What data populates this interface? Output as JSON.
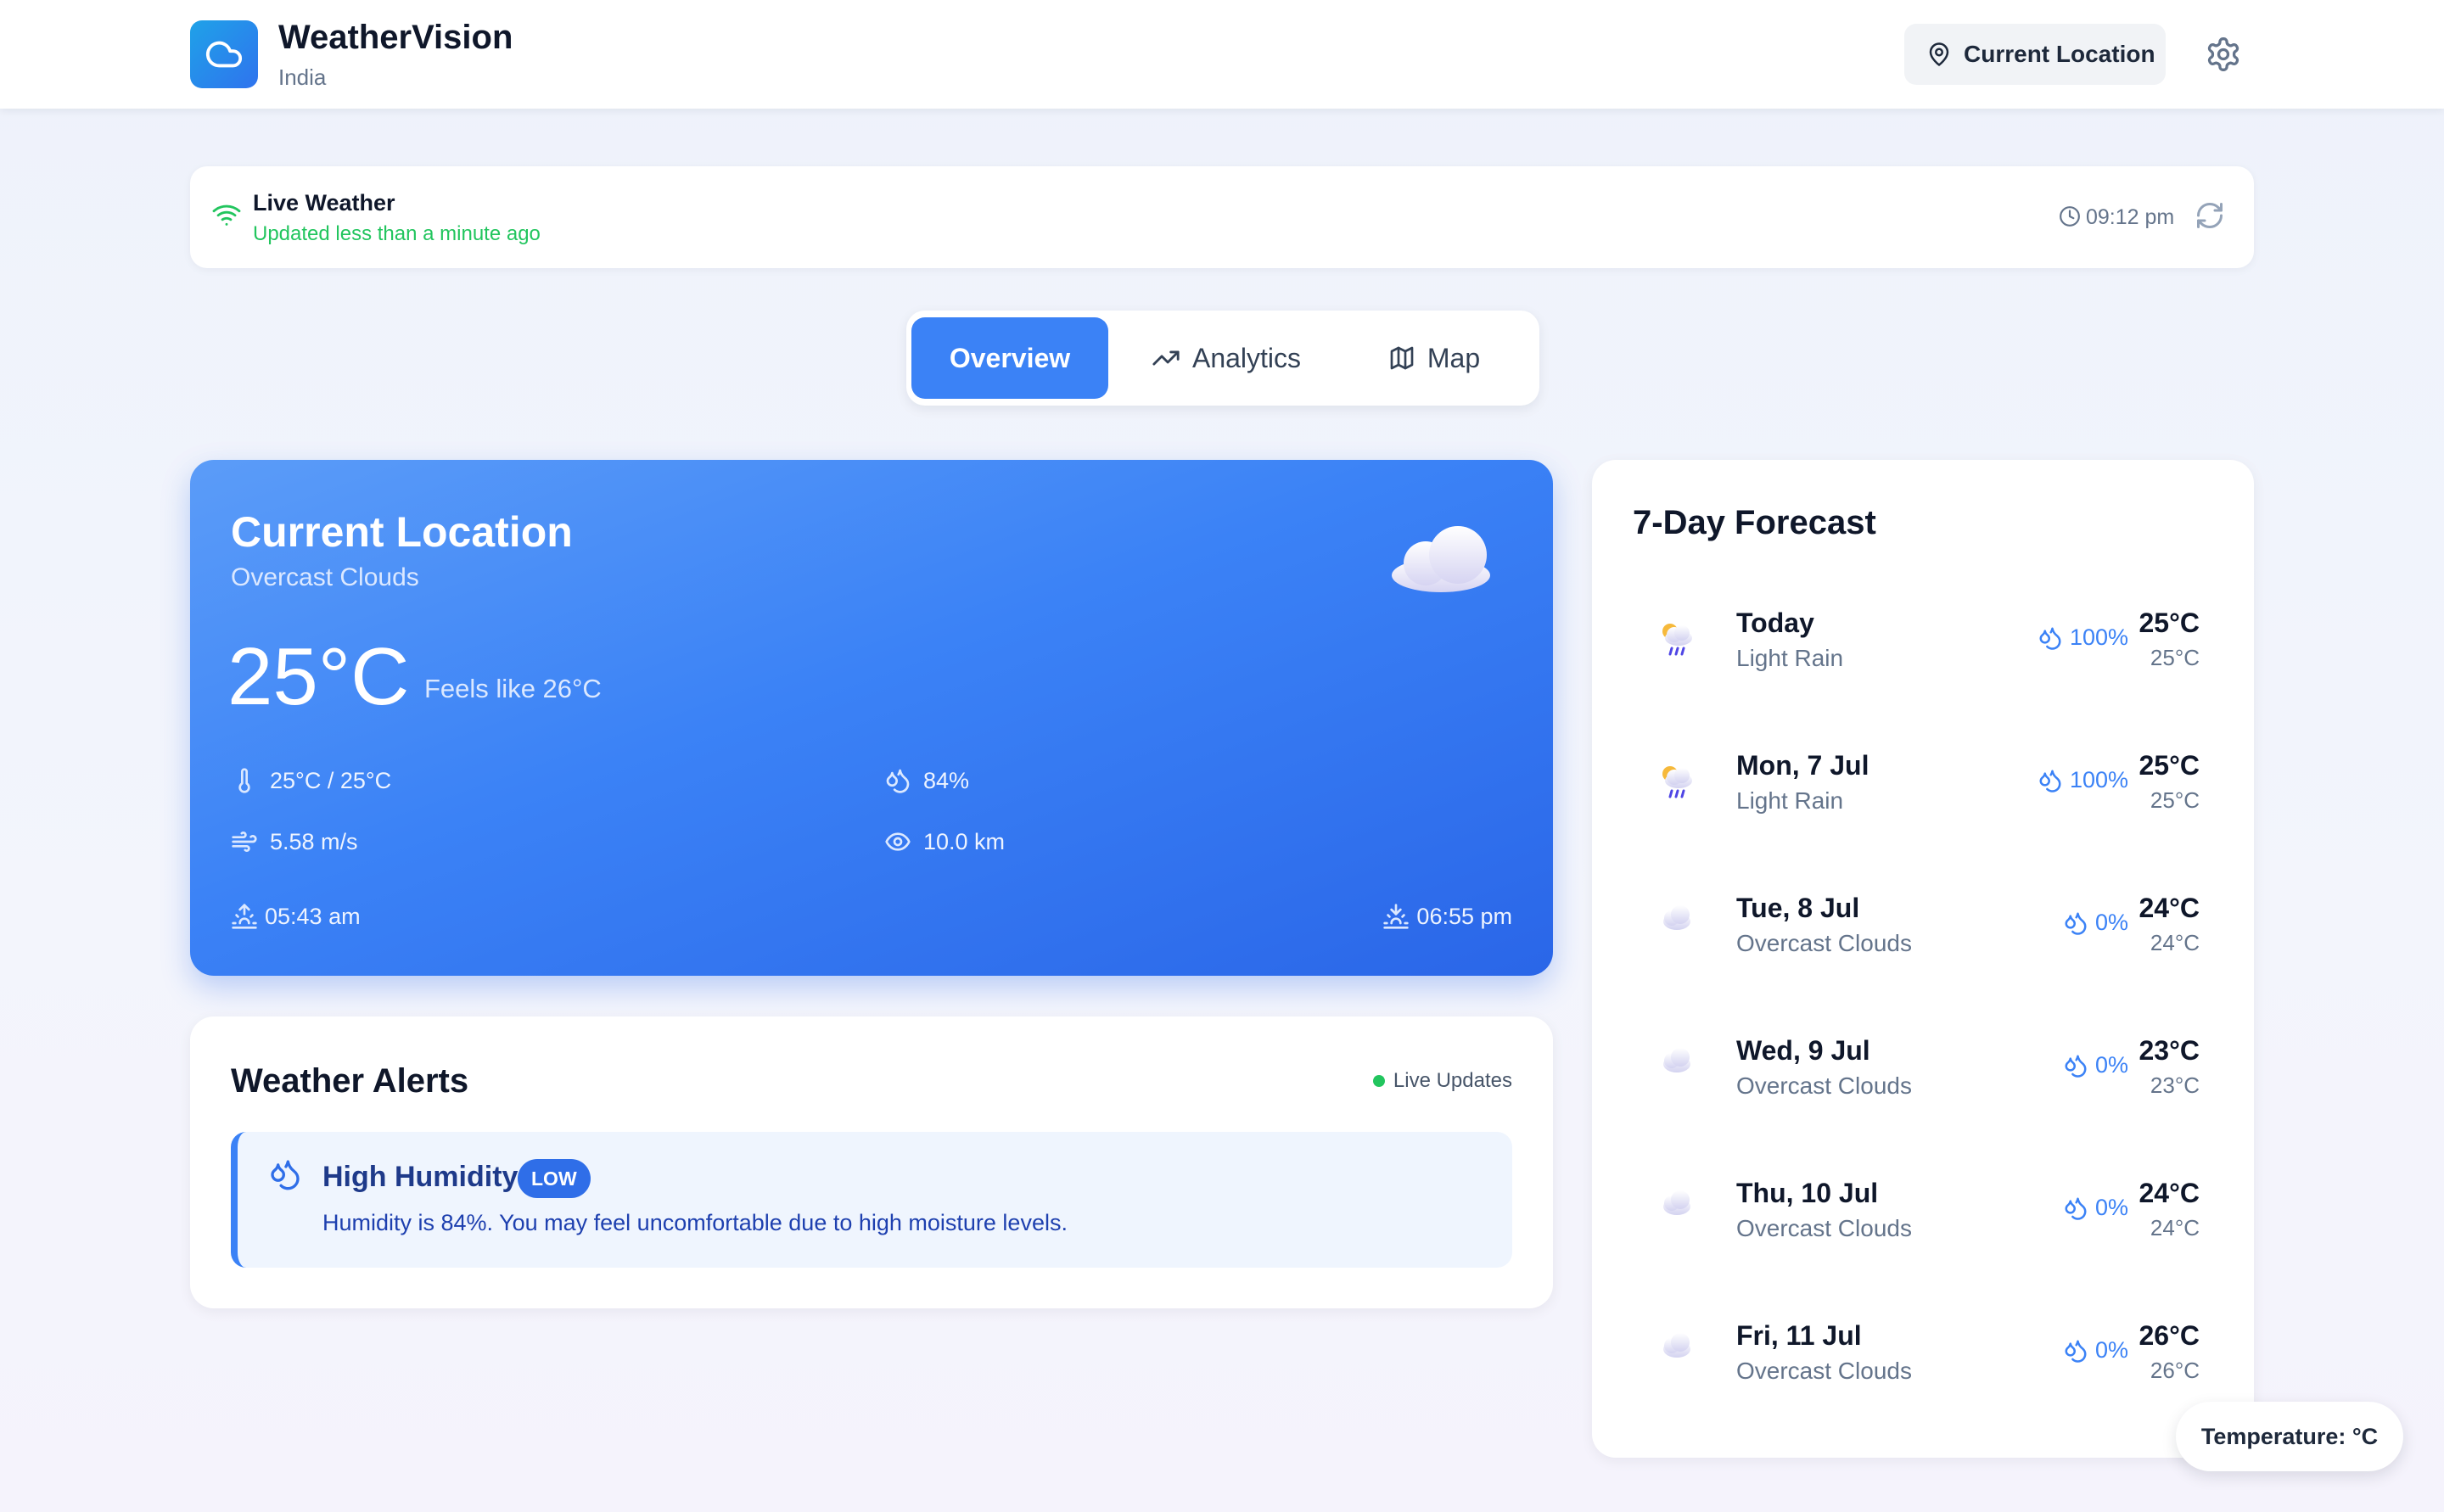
{
  "header": {
    "app_title": "WeatherVision",
    "app_subtitle": "India",
    "location_button": "Current Location",
    "logo_icon": "cloud-icon",
    "settings_icon": "gear-icon"
  },
  "live_bar": {
    "title": "Live Weather",
    "subtitle": "Updated less than a minute ago",
    "time": "09:12 pm"
  },
  "tabs": [
    {
      "label": "Overview",
      "icon": "none"
    },
    {
      "label": "Analytics",
      "icon": "trending-up-icon"
    },
    {
      "label": "Map",
      "icon": "map-icon"
    }
  ],
  "current": {
    "title": "Current Location",
    "description": "Overcast Clouds",
    "temperature": "25°C",
    "feels_like": "Feels like 26°C",
    "high_low": "25°C / 25°C",
    "humidity": "84%",
    "wind": "5.58 m/s",
    "visibility": "10.0 km",
    "sunrise": "05:43 am",
    "sunset": "06:55 pm"
  },
  "alerts": {
    "title": "Weather Alerts",
    "live_label": "Live Updates",
    "items": [
      {
        "name": "High Humidity",
        "severity": "LOW",
        "message": "Humidity is 84%. You may feel uncomfortable due to high moisture levels."
      }
    ]
  },
  "forecast": {
    "title": "7-Day Forecast",
    "days": [
      {
        "day": "Today",
        "condition": "Light Rain",
        "rain": "100%",
        "high": "25°C",
        "low": "25°C",
        "icon": "rain-cloud-icon"
      },
      {
        "day": "Mon, 7 Jul",
        "condition": "Light Rain",
        "rain": "100%",
        "high": "25°C",
        "low": "25°C",
        "icon": "rain-cloud-icon"
      },
      {
        "day": "Tue, 8 Jul",
        "condition": "Overcast Clouds",
        "rain": "0%",
        "high": "24°C",
        "low": "24°C",
        "icon": "cloud-icon"
      },
      {
        "day": "Wed, 9 Jul",
        "condition": "Overcast Clouds",
        "rain": "0%",
        "high": "23°C",
        "low": "23°C",
        "icon": "cloud-icon"
      },
      {
        "day": "Thu, 10 Jul",
        "condition": "Overcast Clouds",
        "rain": "0%",
        "high": "24°C",
        "low": "24°C",
        "icon": "cloud-icon"
      },
      {
        "day": "Fri, 11 Jul",
        "condition": "Overcast Clouds",
        "rain": "0%",
        "high": "26°C",
        "low": "26°C",
        "icon": "cloud-icon"
      }
    ]
  },
  "unit_toggle": "Temperature: °C",
  "colors": {
    "accent": "#3b82f6",
    "live_green": "#22c55e",
    "card_gradient_start": "#5b9cf8",
    "card_gradient_end": "#2a66e8"
  }
}
